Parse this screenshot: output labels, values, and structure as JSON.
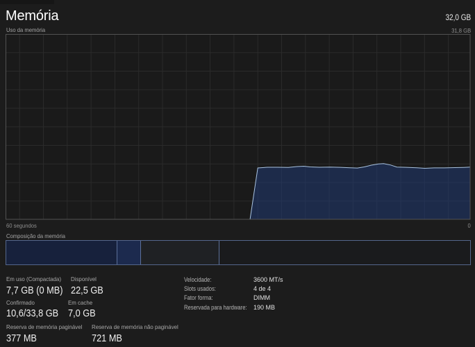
{
  "header": {
    "title": "Memória",
    "total_capacity": "32,0 GB"
  },
  "graph": {
    "label": "Uso da memória",
    "max_label": "31,8 GB",
    "x_left_label": "60 segundos",
    "x_right_label": "0"
  },
  "chart_data": {
    "type": "area",
    "title": "Uso da memória",
    "xlabel": "60 segundos",
    "ylabel": "31,8 GB",
    "x_axis": "seconds ago (left = 60, right = 0)",
    "xlim": [
      60,
      0
    ],
    "ylim": [
      0,
      31.8
    ],
    "grid": true,
    "series_name": "Memory usage (GB)",
    "points": [
      [
        28.45,
        0.0
      ],
      [
        27.45,
        8.86
      ],
      [
        26.2,
        8.98
      ],
      [
        24.9,
        8.98
      ],
      [
        23.5,
        8.94
      ],
      [
        22.4,
        9.1
      ],
      [
        21.5,
        9.15
      ],
      [
        20.7,
        9.03
      ],
      [
        19.5,
        8.98
      ],
      [
        18.1,
        9.0
      ],
      [
        16.8,
        8.96
      ],
      [
        15.5,
        8.89
      ],
      [
        14.6,
        8.85
      ],
      [
        13.7,
        9.03
      ],
      [
        12.8,
        9.33
      ],
      [
        11.9,
        9.53
      ],
      [
        11.2,
        9.59
      ],
      [
        10.3,
        9.36
      ],
      [
        9.5,
        9.01
      ],
      [
        8.3,
        8.96
      ],
      [
        6.9,
        8.88
      ],
      [
        5.9,
        8.8
      ],
      [
        4.7,
        8.87
      ],
      [
        3.4,
        8.87
      ],
      [
        2.0,
        8.91
      ],
      [
        0.85,
        8.95
      ],
      [
        0.0,
        9.0
      ]
    ],
    "colors": {
      "line": "#a9c3e1",
      "fill": "rgba(33,58,114,0.55)",
      "plot_background": "#1a1a1a",
      "grid_line": "#2b2b2b",
      "border": "#525252"
    }
  },
  "composition": {
    "label": "Composição da memória",
    "segments": [
      {
        "name": "in-use",
        "fraction": 0.2389,
        "color": "#17213c"
      },
      {
        "name": "modified",
        "fraction": 0.0514,
        "color": "#1c2a4e"
      },
      {
        "name": "standby",
        "fraction": 0.1698,
        "color": "#1f2124"
      },
      {
        "name": "free",
        "fraction": 0.5399,
        "color": "#1a1b1d"
      }
    ]
  },
  "stats": {
    "items": [
      {
        "label": "Em uso (Compactada)",
        "value": "7,7 GB (0 MB)"
      },
      {
        "label": "Disponível",
        "value": "22,5 GB"
      },
      {
        "label": "Confirmado",
        "value": "10,6/33,8 GB"
      },
      {
        "label": "Em cache",
        "value": "7,0 GB"
      },
      {
        "label": "Reserva de memória paginável",
        "value": "377 MB"
      },
      {
        "label": "Reserva de memória não paginável",
        "value": "721 MB"
      }
    ]
  },
  "details": {
    "items": [
      {
        "label": "Velocidade:",
        "value": "3600 MT/s"
      },
      {
        "label": "Slots usados:",
        "value": "4 de 4"
      },
      {
        "label": "Fator forma:",
        "value": "DIMM"
      },
      {
        "label": "Reservada para hardware:",
        "value": "190 MB"
      }
    ]
  }
}
